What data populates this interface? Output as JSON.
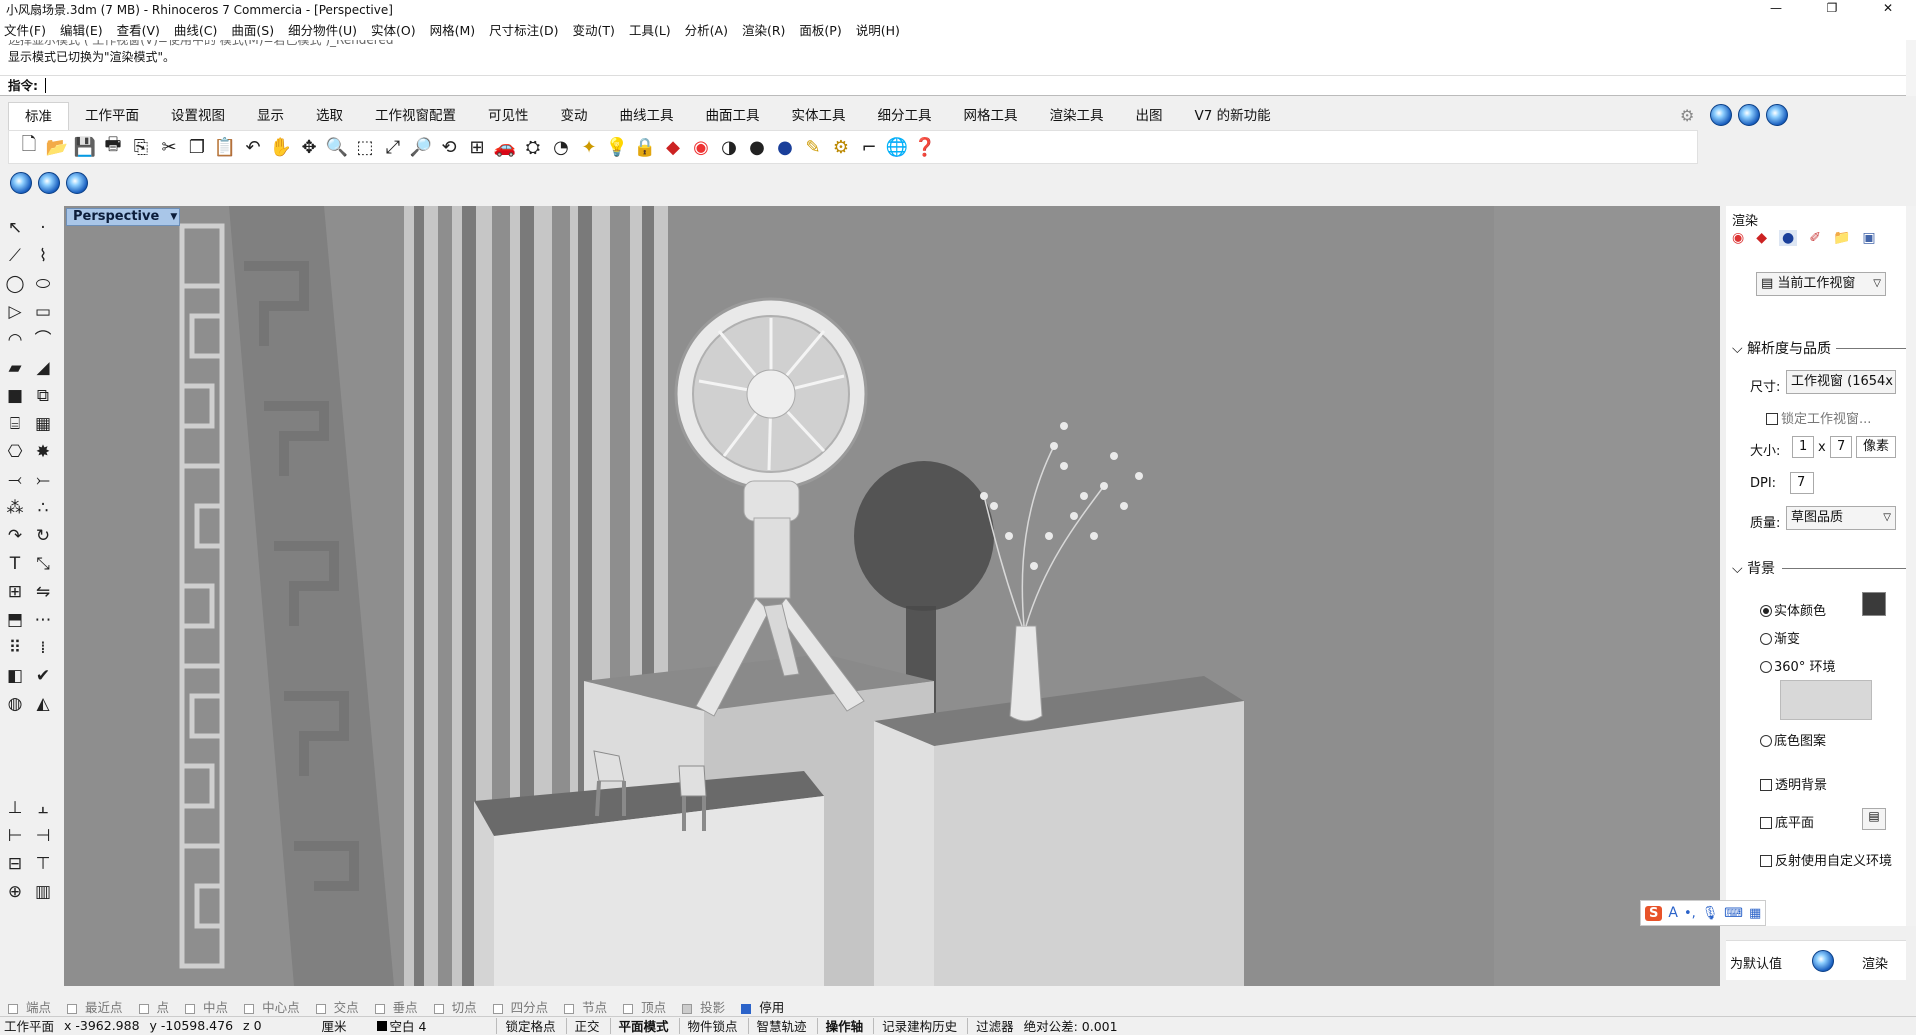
{
  "window": {
    "title": "小风扇场景.3dm (7 MB) - Rhinoceros 7 Commercia - [Perspective]",
    "controls": [
      "—",
      "❐",
      "✕"
    ]
  },
  "menu": [
    "文件(F)",
    "编辑(E)",
    "查看(V)",
    "曲线(C)",
    "曲面(S)",
    "细分物件(U)",
    "实体(O)",
    "网格(M)",
    "尺寸标注(D)",
    "变动(T)",
    "工具(L)",
    "分析(A)",
    "渲染(R)",
    "面板(P)",
    "说明(H)"
  ],
  "command": {
    "history_faded": "选择显示模式 ( 工作视窗(V)=使用中的 模式(M)=若已模式 )_Rendered",
    "history_last": "显示模式已切换为\"渲染模式\"。",
    "prompt": "指令:"
  },
  "tabs": [
    "标准",
    "工作平面",
    "设置视图",
    "显示",
    "选取",
    "工作视窗配置",
    "可见性",
    "变动",
    "曲线工具",
    "曲面工具",
    "实体工具",
    "细分工具",
    "网格工具",
    "渲染工具",
    "出图",
    "V7 的新功能"
  ],
  "viewport": {
    "label": "Perspective",
    "bg_color": "#8f8f8f"
  },
  "panel": {
    "title": "渲染",
    "view_dropdown": "当前工作视窗",
    "section_resolution": "解析度与品质",
    "size_label": "尺寸:",
    "size_value": "工作视窗 (1654x",
    "lock_viewport": "锁定工作视窗...",
    "dims_label": "大小:",
    "dims_w": "1",
    "dims_x": "x",
    "dims_h": "7",
    "dims_unit": "像素",
    "dpi_label": "DPI:",
    "dpi_value": "7",
    "quality_label": "质量:",
    "quality_value": "草图品质",
    "section_background": "背景",
    "bg_solid": "实体颜色",
    "bg_gradient": "渐变",
    "bg_360": "360° 环境",
    "bg_wallpaper": "底色图案",
    "transparent_bg": "透明背景",
    "ground_plane": "底平面",
    "custom_reflect": "反射使用自定义环境",
    "solid_color": "#3a3a3a",
    "set_default": "为默认值",
    "render_button": "渲染"
  },
  "osnap": [
    "端点",
    "最近点",
    "点",
    "中点",
    "中心点",
    "交点",
    "垂点",
    "切点",
    "四分点",
    "节点",
    "顶点",
    "投影",
    "停用"
  ],
  "status": {
    "cplane": "工作平面",
    "x": "x -3962.988",
    "y": "y -10598.476",
    "z": "z 0",
    "unit": "厘米",
    "layer": "空白 4",
    "toggles": [
      "锁定格点",
      "正交",
      "平面模式",
      "物件锁点",
      "智慧轨迹",
      "操作轴",
      "记录建构历史",
      "过滤器"
    ],
    "tolerance": "绝对公差: 0.001"
  },
  "icons": {
    "toolbar": [
      "new-file-icon",
      "open-icon",
      "save-icon",
      "print-icon",
      "import-icon",
      "cut-icon",
      "copy-icon",
      "paste-icon",
      "undo-icon",
      "pan-icon",
      "rotate-view-icon",
      "zoom-icon",
      "zoom-window-icon",
      "zoom-extents-icon",
      "zoom-selected-icon",
      "rotate-icon",
      "four-view-icon",
      "car-icon",
      "named-view-icon",
      "camera-icon",
      "light-icon",
      "bulb-icon",
      "lock-icon",
      "layer-icon",
      "color-wheel-icon",
      "shade-icon",
      "render-sphere-icon",
      "blue-sphere-icon",
      "pen-icon",
      "gear-icon",
      "dimension-icon",
      "globe-icon",
      "help-icon"
    ]
  }
}
